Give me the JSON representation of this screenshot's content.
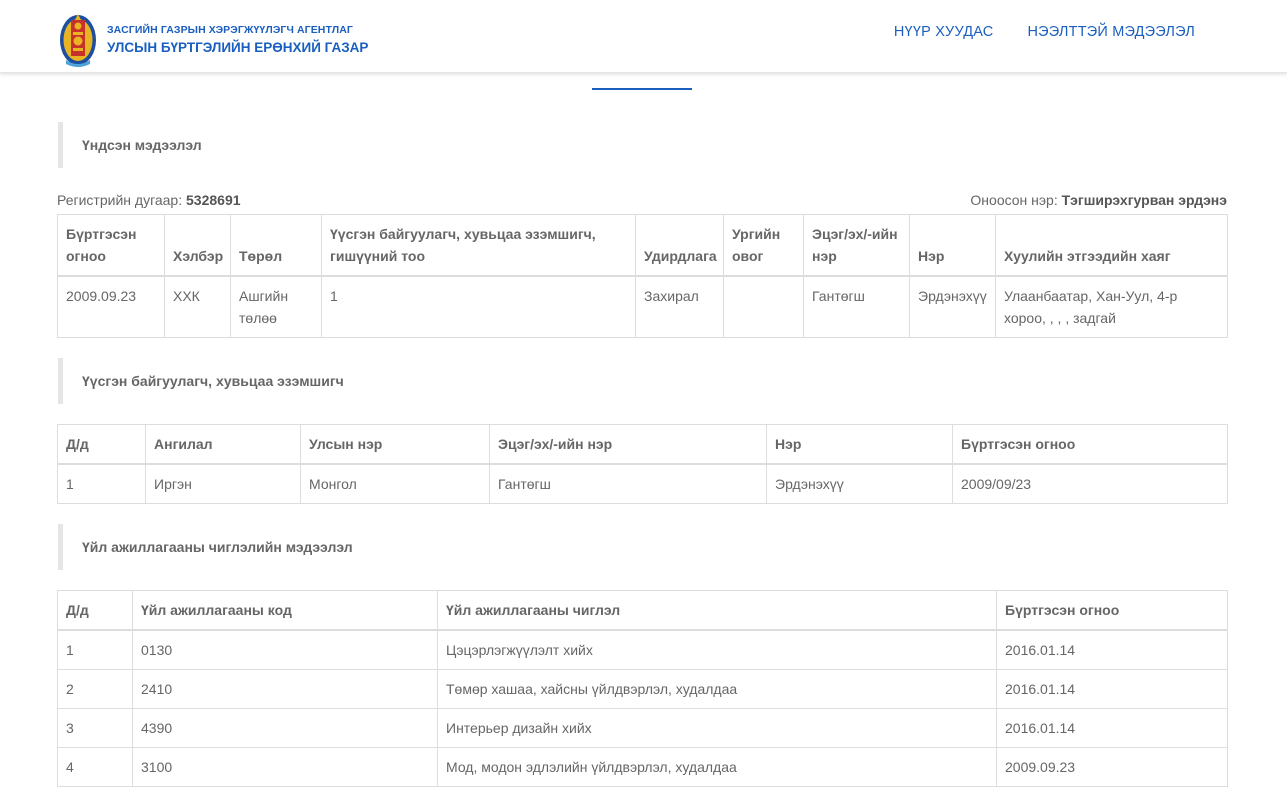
{
  "header": {
    "org_line1": "ЗАСГИЙН ГАЗРЫН ХЭРЭГЖҮҮЛЭГЧ АГЕНТЛАГ",
    "org_line2": "УЛСЫН БҮРТГЭЛИЙН ЕРӨНХИЙ ГАЗАР",
    "nav": [
      "НҮҮР ХУУДАС",
      "НЭЭЛТТЭЙ МЭДЭЭЛЭЛ"
    ],
    "logo_icon": "soyombo-emblem-icon"
  },
  "colors": {
    "accent": "#1a5fbf",
    "emblem_gold": "#e9b423",
    "emblem_blue": "#1d4f9e"
  },
  "sections": {
    "basic": "Үндсэн мэдээлэл",
    "founders": "Үүсгэн байгуулагч, хувьцаа эзэмшигч",
    "activities": "Үйл ажиллагааны чиглэлийн мэдээлэл"
  },
  "registry": {
    "label": "Регистрийн дугаар:",
    "number": "5328691",
    "name_label": "Оноосон нэр:",
    "name": "Тэгширэхгурван эрдэнэ"
  },
  "basic_table": {
    "headers": [
      "Бүртгэсэн огноо",
      "Хэлбэр",
      "Төрөл",
      "Үүсгэн байгуулагч, хувьцаа эзэмшигч, гишүүний тоо",
      "Удирдлага",
      "Ургийн овог",
      "Эцэг/эх/-ийн нэр",
      "Нэр",
      "Хуулийн этгээдийн хаяг"
    ],
    "row": [
      "2009.09.23",
      "ХХК",
      "Ашгийн төлөө",
      "1",
      "Захирал",
      "",
      "Гантөгш",
      "Эрдэнэхүү",
      "Улаанбаатар, Хан-Уул, 4-р хороо, , , , задгай"
    ]
  },
  "founders_table": {
    "headers": [
      "Д/д",
      "Ангилал",
      "Улсын нэр",
      "Эцэг/эх/-ийн нэр",
      "Нэр",
      "Бүртгэсэн огноо"
    ],
    "rows": [
      [
        "1",
        "Иргэн",
        "Монгол",
        "Гантөгш",
        "Эрдэнэхүү",
        "2009/09/23"
      ]
    ]
  },
  "activities_table": {
    "headers": [
      "Д/д",
      "Үйл ажиллагааны код",
      "Үйл ажиллагааны чиглэл",
      "Бүртгэсэн огноо"
    ],
    "rows": [
      [
        "1",
        "0130",
        "Цэцэрлэгжүүлэлт хийх",
        "2016.01.14"
      ],
      [
        "2",
        "2410",
        "Төмөр хашаа, хайсны үйлдвэрлэл, худалдаа",
        "2016.01.14"
      ],
      [
        "3",
        "4390",
        "Интерьер дизайн хийх",
        "2016.01.14"
      ],
      [
        "4",
        "3100",
        "Мод, модон эдлэлийн үйлдвэрлэл, худалдаа",
        "2009.09.23"
      ]
    ]
  }
}
